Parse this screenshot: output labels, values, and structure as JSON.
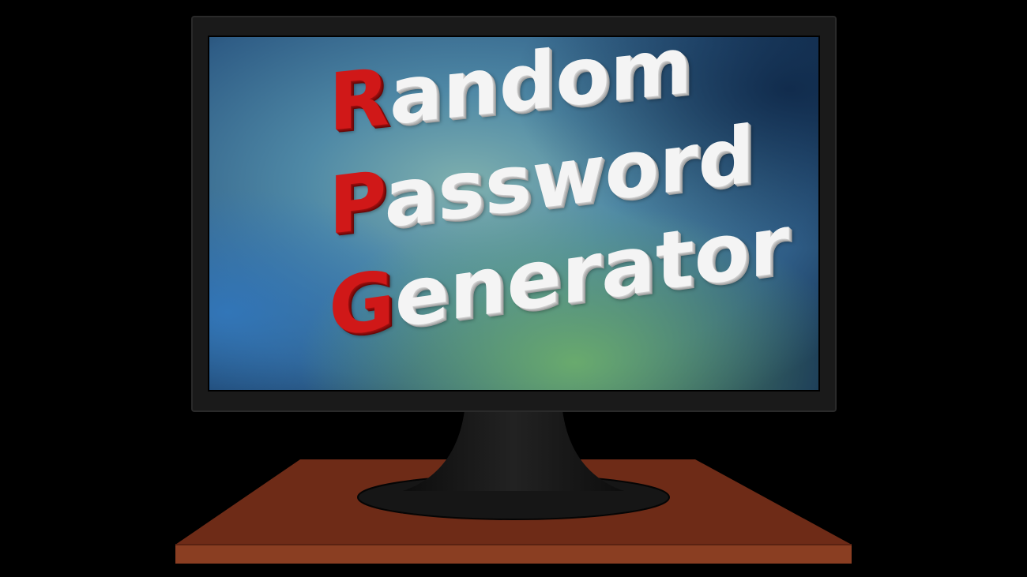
{
  "screen_text": {
    "line1": {
      "initial": "R",
      "rest": "andom"
    },
    "line2": {
      "initial": "P",
      "rest": "assword"
    },
    "line3": {
      "initial": "G",
      "rest": "enerator"
    }
  },
  "colors": {
    "background": "#000000",
    "monitor_bezel": "#1a1a1a",
    "desk_top": "#6e2b17",
    "desk_edge": "#8a3e22",
    "initial_letters": "#d01818",
    "word_letters": "#f4f4f4"
  }
}
